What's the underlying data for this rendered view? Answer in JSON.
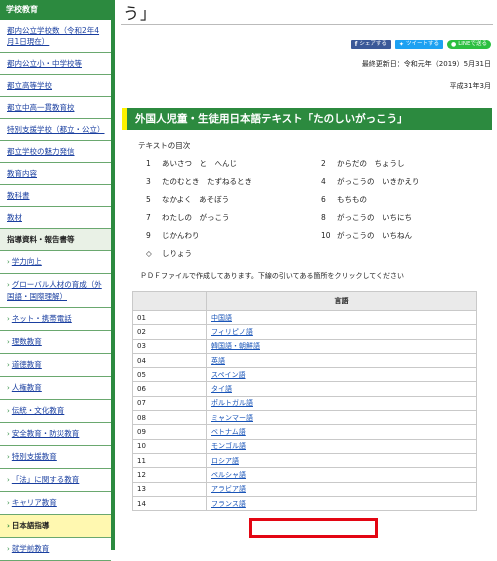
{
  "sidebar": {
    "header": "学校教育",
    "items": [
      {
        "label": "都内公立学校数（令和2年4月1日現在）",
        "type": "link"
      },
      {
        "label": "都内公立小・中学校等",
        "type": "link"
      },
      {
        "label": "都立高等学校",
        "type": "link"
      },
      {
        "label": "都立中高一貫教育校",
        "type": "link"
      },
      {
        "label": "特別支援学校（都立・公立）",
        "type": "link"
      },
      {
        "label": "都立学校の魅力発信",
        "type": "link"
      },
      {
        "label": "教育内容",
        "type": "link"
      },
      {
        "label": "教科書",
        "type": "link"
      },
      {
        "label": "教材",
        "type": "link"
      },
      {
        "label": "指導資料・報告書等",
        "type": "section"
      },
      {
        "label": "学力向上",
        "type": "sub"
      },
      {
        "label": "グローバル人材の育成（外国語・国際理解）",
        "type": "sub"
      },
      {
        "label": "ネット・携帯電話",
        "type": "sub"
      },
      {
        "label": "理数教育",
        "type": "sub"
      },
      {
        "label": "道徳教育",
        "type": "sub"
      },
      {
        "label": "人権教育",
        "type": "sub"
      },
      {
        "label": "伝統・文化教育",
        "type": "sub"
      },
      {
        "label": "安全教育・防災教育",
        "type": "sub"
      },
      {
        "label": "特別支援教育",
        "type": "sub"
      },
      {
        "label": "「法」に関する教育",
        "type": "sub"
      },
      {
        "label": "キャリア教育",
        "type": "sub"
      },
      {
        "label": "日本語指導",
        "type": "active"
      },
      {
        "label": "就学前教育",
        "type": "sub"
      }
    ]
  },
  "main": {
    "top_title": "う」",
    "share": {
      "facebook": "シェアする",
      "twitter": "ツイートする",
      "line": "LINEで送る"
    },
    "updated": "最終更新日：令和元年（2019）5月31日",
    "pubdate": "平成31年3月",
    "heading": "外国人児童・生徒用日本語テキスト「たのしいがっこう」",
    "toc_title": "テキストの目次",
    "toc": [
      {
        "left": {
          "num": "1",
          "text": "あいさつ　と　へんじ"
        },
        "right": {
          "num": "2",
          "text": "からだの　ちょうし"
        }
      },
      {
        "left": {
          "num": "3",
          "text": "たのむとき　たずねるとき"
        },
        "right": {
          "num": "4",
          "text": "がっこうの　いきかえり"
        }
      },
      {
        "left": {
          "num": "5",
          "text": "なかよく　あそぼう"
        },
        "right": {
          "num": "6",
          "text": "もちもの"
        }
      },
      {
        "left": {
          "num": "7",
          "text": "わたしの　がっこう"
        },
        "right": {
          "num": "8",
          "text": "がっこうの　いちにち"
        }
      },
      {
        "left": {
          "num": "9",
          "text": "じかんわり"
        },
        "right": {
          "num": "10",
          "text": "がっこうの　いちねん"
        }
      },
      {
        "left": {
          "num": "◇",
          "text": "しりょう"
        },
        "right": {
          "num": "",
          "text": ""
        }
      }
    ],
    "pdf_note": "ＰＤＦファイルで作成してあります。下線の引いてある箇所をクリックしてください",
    "table": {
      "header_blank": "",
      "header_lang": "言語",
      "rows": [
        {
          "num": "01",
          "lang": "中国語"
        },
        {
          "num": "02",
          "lang": "フィリピノ語"
        },
        {
          "num": "03",
          "lang": "韓国語・朝鮮語"
        },
        {
          "num": "04",
          "lang": "英語"
        },
        {
          "num": "05",
          "lang": "スペイン語"
        },
        {
          "num": "06",
          "lang": "タイ語"
        },
        {
          "num": "07",
          "lang": "ポルトガル語"
        },
        {
          "num": "08",
          "lang": "ミャンマー語"
        },
        {
          "num": "09",
          "lang": "ベトナム語"
        },
        {
          "num": "10",
          "lang": "モンゴル語"
        },
        {
          "num": "11",
          "lang": "ロシア語"
        },
        {
          "num": "12",
          "lang": "ペルシャ語"
        },
        {
          "num": "13",
          "lang": "アラビア語"
        },
        {
          "num": "14",
          "lang": "フランス語"
        }
      ]
    }
  },
  "colors": {
    "sidebar_green": "#2c8a3f",
    "heading_accent": "#fff200",
    "highlight": "#e30613"
  }
}
